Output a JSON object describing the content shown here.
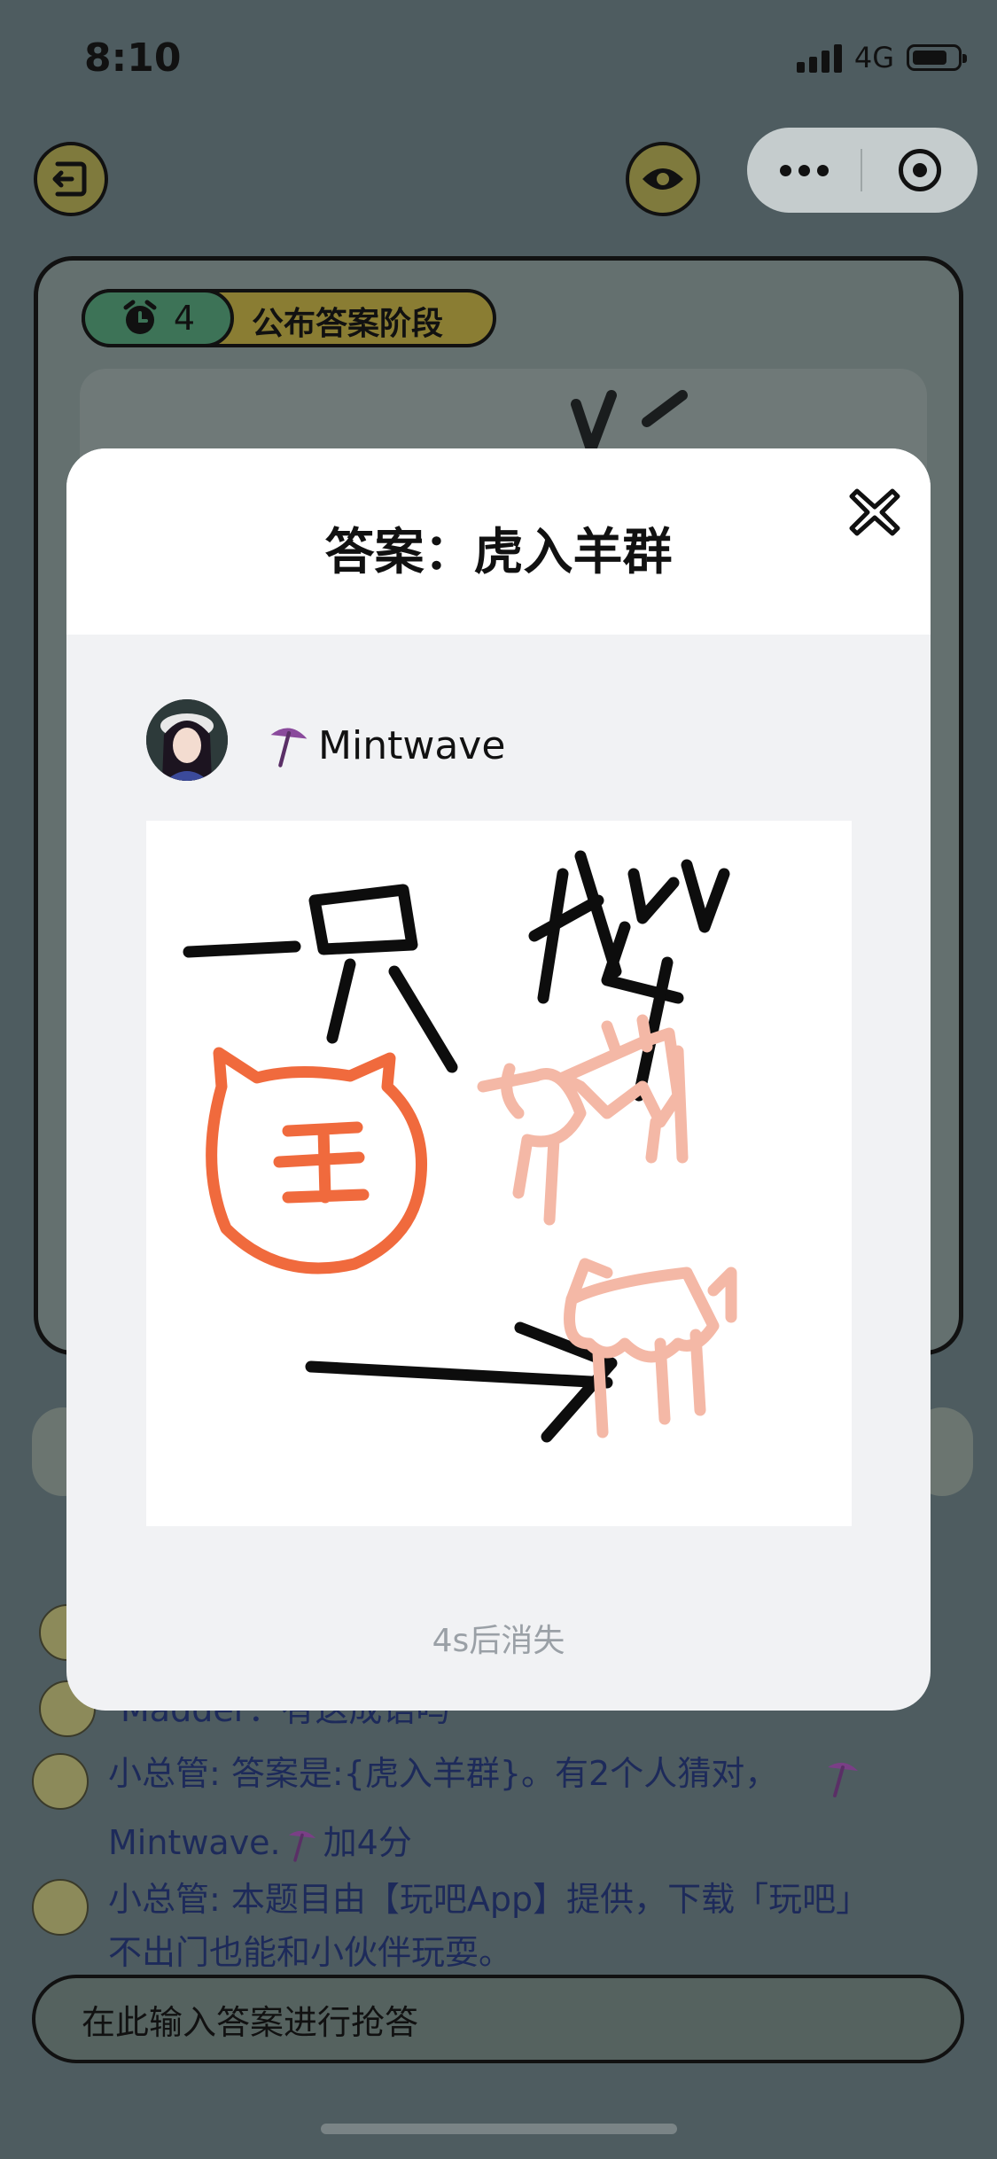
{
  "status_bar": {
    "time": "8:10",
    "network": "4G"
  },
  "top_bar": {
    "exit_icon": "exit-icon",
    "eye_icon": "eye-icon",
    "more_icon": "more-dots-icon",
    "record_icon": "target-icon"
  },
  "game": {
    "timer_value": "4",
    "phase_label": "公布答案阶段"
  },
  "chat": {
    "messages": [
      {
        "author": "Madder",
        "text": "Madder：有这成语吗"
      },
      {
        "author": "小总管",
        "text": "小总管: 答案是:{虎入羊群}。有2个人猜对，",
        "text2": "Mintwave.",
        "text3": "加4分"
      },
      {
        "author": "小总管",
        "text": "小总管: 本题目由【玩吧App】提供，下载「玩吧」",
        "text2": "不出门也能和小伙伴玩耍。"
      }
    ],
    "input_placeholder": "在此输入答案进行抢答"
  },
  "modal": {
    "title": "答案：虎入羊群",
    "user_name": "Mintwave",
    "countdown": "4s后消失",
    "close_icon": "close-icon",
    "badge_icon": "umbrella-icon"
  },
  "colors": {
    "overlay_bg": "#4e5c60",
    "phase_bg": "#8a7d33",
    "timer_bg": "#3d7357",
    "tiger_stroke": "#f06a3d",
    "sheep_stroke": "#f4b8a6",
    "chat_text": "#1d2a5a"
  }
}
